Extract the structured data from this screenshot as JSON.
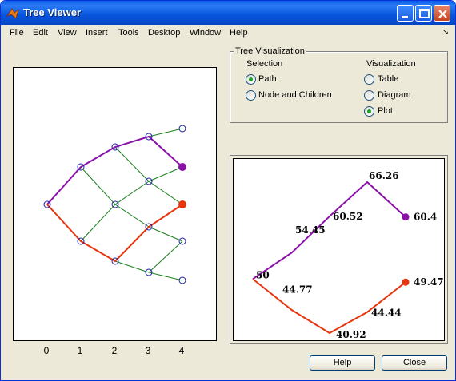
{
  "window": {
    "title": "Tree Viewer"
  },
  "menu": [
    "File",
    "Edit",
    "View",
    "Insert",
    "Tools",
    "Desktop",
    "Window",
    "Help"
  ],
  "left_plot": {
    "xticks": [
      "0",
      "1",
      "2",
      "3",
      "4"
    ]
  },
  "panel": {
    "title": "Tree Visualization",
    "selection": {
      "label": "Selection",
      "options": [
        "Path",
        "Node and Children"
      ],
      "selected": "Path"
    },
    "visualization": {
      "label": "Visualization",
      "options": [
        "Table",
        "Diagram",
        "Plot"
      ],
      "selected": "Plot"
    }
  },
  "chart_data": {
    "type": "line",
    "series": [
      {
        "color": "#8b10a8",
        "points": [
          "50",
          "54.45",
          "60.52",
          "66.26",
          "60.4"
        ]
      },
      {
        "color": "#e8340e",
        "points": [
          "50",
          "44.77",
          "40.92",
          "44.44",
          "49.47"
        ]
      }
    ]
  },
  "buttons": {
    "help": "Help",
    "close": "Close"
  },
  "colors": {
    "tree_lines": "#1a7f1a",
    "node": "#1a1aa8",
    "path_up": "#8b10a8",
    "path_down": "#e8340e"
  }
}
